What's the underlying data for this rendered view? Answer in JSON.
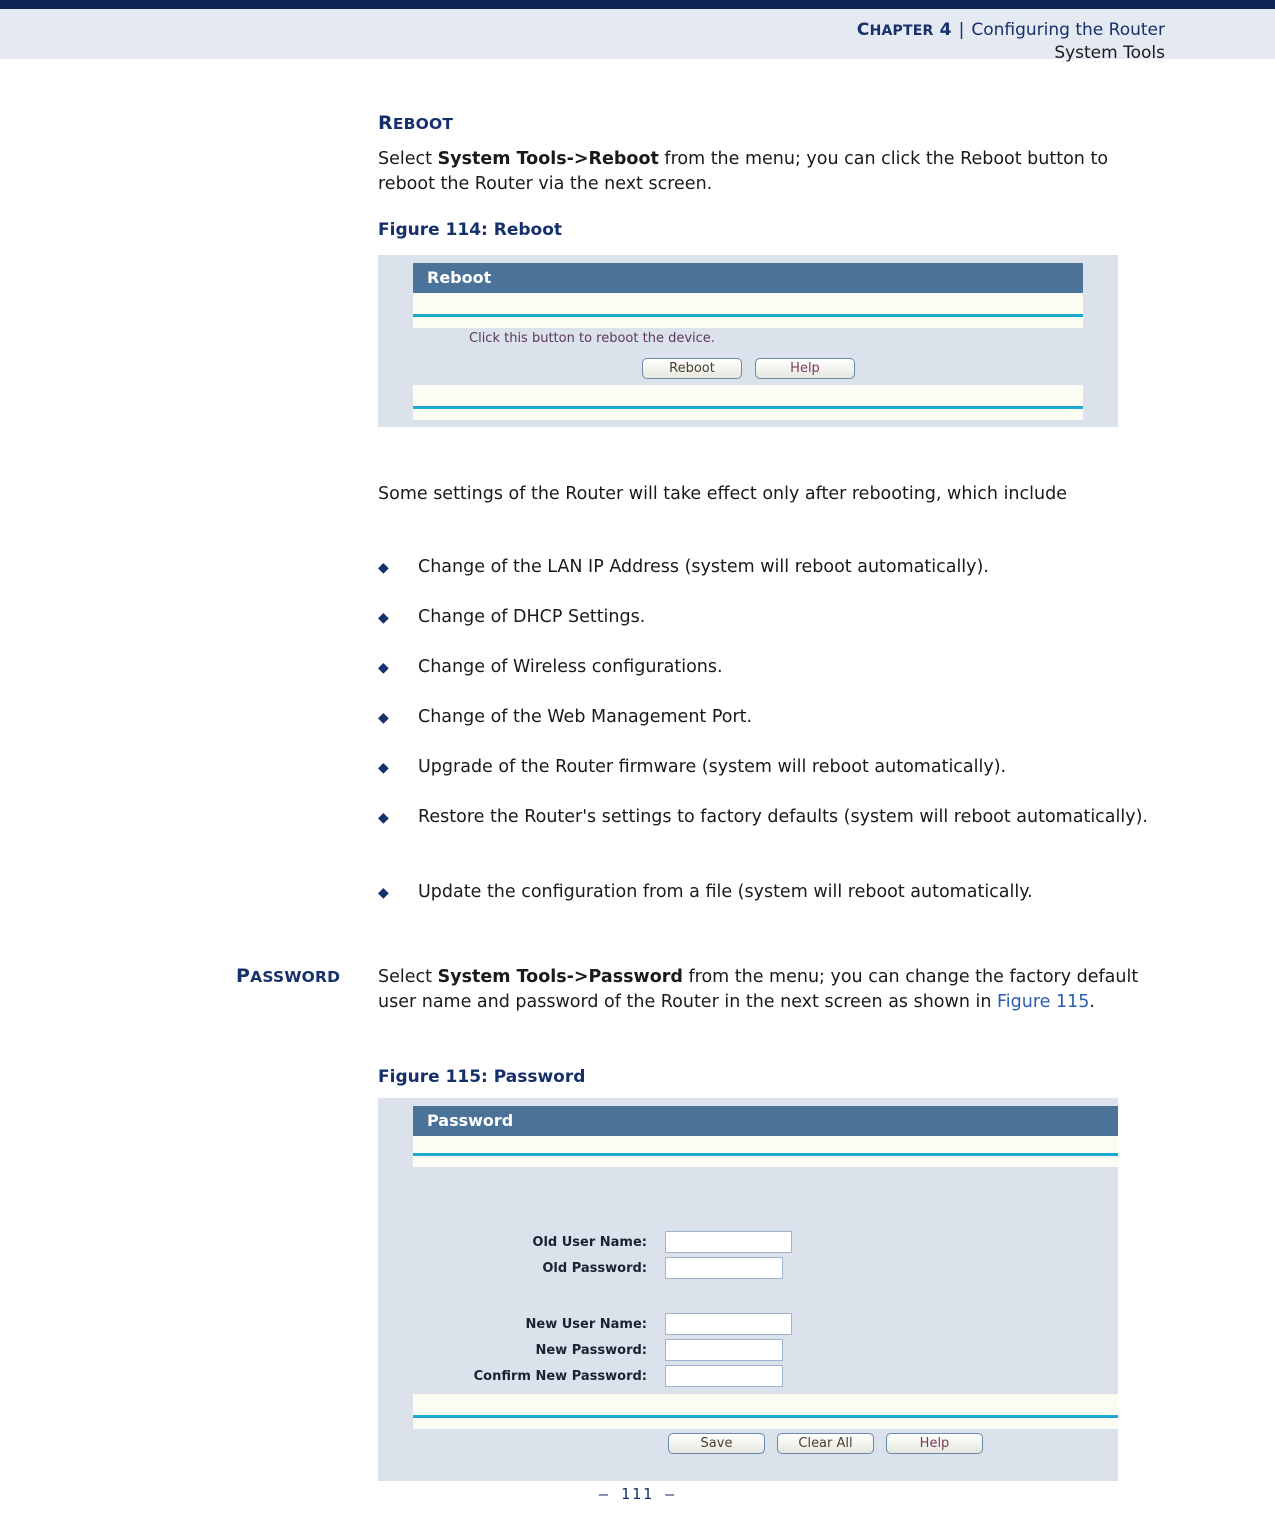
{
  "header": {
    "chapter_label": "Chapter 4",
    "separator": "|",
    "chapter_title": "Configuring the Router",
    "subtitle": "System Tools"
  },
  "sections": {
    "reboot": {
      "heading": "Reboot",
      "intro_prefix": "Select ",
      "intro_bold": "System Tools->Reboot",
      "intro_suffix": " from the menu; you can click the Reboot button to reboot the Router via the next screen.",
      "figure_caption": "Figure 114:  Reboot",
      "after_figure_text": "Some settings of the Router will take effect only after rebooting, which include",
      "bullets": [
        "Change of the LAN IP Address (system will reboot automatically).",
        "Change of DHCP Settings.",
        "Change of Wireless configurations.",
        "Change of the Web Management Port.",
        "Upgrade of the Router firmware (system will reboot automatically).",
        "Restore the Router's settings to factory defaults (system will reboot automatically).",
        "Update the configuration from a file (system will reboot automatically."
      ],
      "bullet_glyph": "◆"
    },
    "password": {
      "heading": "Password",
      "intro_prefix": "Select ",
      "intro_bold": "System Tools->Password",
      "intro_mid": " from the menu; you can change the factory default user name and password of the Router in the next screen as shown in ",
      "intro_xref": "Figure 115",
      "intro_suffix": ".",
      "figure_caption": "Figure 115:  Password"
    }
  },
  "figure_reboot": {
    "title": "Reboot",
    "note": "Click this button to reboot the device.",
    "buttons": [
      {
        "label": "Reboot"
      },
      {
        "label": "Help"
      }
    ]
  },
  "figure_password": {
    "title": "Password",
    "fields": [
      {
        "label": "Old User Name:",
        "value": ""
      },
      {
        "label": "Old Password:",
        "value": ""
      },
      {
        "label": "New User Name:",
        "value": ""
      },
      {
        "label": "New Password:",
        "value": ""
      },
      {
        "label": "Confirm New Password:",
        "value": ""
      }
    ],
    "buttons": [
      {
        "label": "Save"
      },
      {
        "label": "Clear All"
      },
      {
        "label": "Help"
      }
    ]
  },
  "footer": {
    "page_number": "–  111  –"
  },
  "colors": {
    "navy": "#16306b",
    "top_rule": "#0f2452",
    "header_band": "#e4e9f2",
    "ui_titlebar": "#4b7399",
    "ui_panel": "#dbe2ec",
    "ui_strip": "#fcfdf2",
    "ui_rule": "#1aa7d0",
    "xref_link": "#2a5db0",
    "ui_note_text": "#5b3a55"
  }
}
